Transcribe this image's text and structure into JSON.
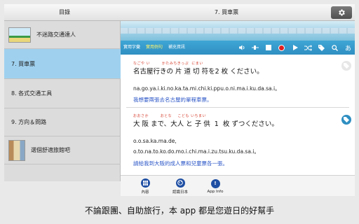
{
  "header": {
    "toc_title": "目錄",
    "lesson_title": "7. 買車票"
  },
  "sidebar": {
    "items": [
      {
        "label": "不迷路交通達人",
        "has_thumb": true
      },
      {
        "label": "7. 買車票",
        "selected": true
      },
      {
        "label": "8. 各式交通工具"
      },
      {
        "label": "9. 方向＆問路"
      },
      {
        "label": "選個舒適旅館吧",
        "has_thumb": true
      }
    ]
  },
  "toolbar": {
    "tab1": "實用字彙",
    "tab2": "實用例句",
    "tab3": "補充資訊"
  },
  "sentences": [
    {
      "furigana": "なごや い        かたみちきっぷ  にまい",
      "japanese": "名古屋行きの 片 道 切 符を2 枚 ください。",
      "romaji": "na.go.ya.i.ki.no.ka.ta.mi.chi.ki.ppu.o.ni.ma.i.ku.da.sa.i。",
      "chinese": "我想要兩張去名古屋的單程車票。"
    },
    {
      "furigana": "おおさか        おとな    こども いちまい",
      "japanese": "大 阪 まで、大人 と 子 供  1  枚 ずつください。",
      "romaji1": "o.o.sa.ka.ma.de,",
      "romaji2": "o.to.na.to.ko.do.mo.i.chi.ma.i.zu.tsu.ku.da.sa.i。",
      "chinese": "請給我到大阪的成人票和兒童票各一張。"
    }
  ],
  "tabs": {
    "contents": "內容",
    "about_japan": "認識日本",
    "app_info": "App Info"
  },
  "caption": "不論跟團、自助旅行，本 app 都是您遊日的好幫手",
  "colors": {
    "accent": "#2f8fc2",
    "selected_row": "#9fd1ef",
    "furigana": "#d43b2a",
    "translation": "#2a55c7"
  }
}
